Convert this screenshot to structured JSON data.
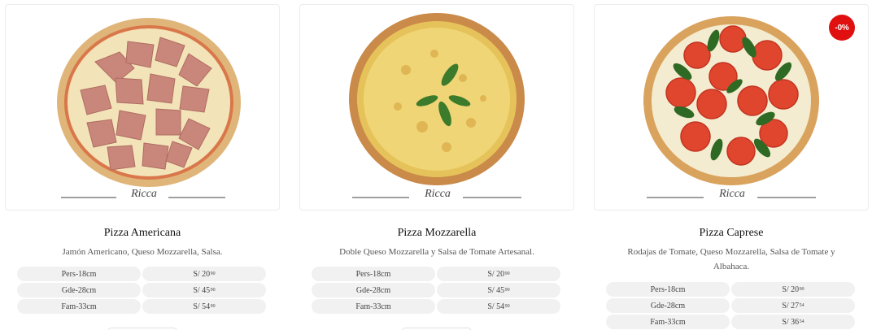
{
  "products": [
    {
      "name": "Pizza Americana",
      "description": "Jamón Americano, Queso Mozzarella, Salsa.",
      "brand": "Ricca",
      "sizes": [
        {
          "label": "Pers-18cm",
          "price_main": "S/ 20",
          "price_cents": "90"
        },
        {
          "label": "Gde-28cm",
          "price_main": "S/ 45",
          "price_cents": "90"
        },
        {
          "label": "Fam-33cm",
          "price_main": "S/ 54",
          "price_cents": "90"
        }
      ]
    },
    {
      "name": "Pizza Mozzarella",
      "description": "Doble Queso Mozzarella y Salsa de Tomate Artesanal.",
      "brand": "Ricca",
      "sizes": [
        {
          "label": "Pers-18cm",
          "price_main": "S/ 20",
          "price_cents": "90"
        },
        {
          "label": "Gde-28cm",
          "price_main": "S/ 45",
          "price_cents": "90"
        },
        {
          "label": "Fam-33cm",
          "price_main": "S/ 54",
          "price_cents": "90"
        }
      ]
    },
    {
      "name": "Pizza Caprese",
      "description": "Rodajas de Tomate, Queso Mozzarella, Salsa de Tomate y Albahaca.",
      "brand": "Ricca",
      "discount_badge": "-0%",
      "sizes": [
        {
          "label": "Pers-18cm",
          "price_main": "S/ 20",
          "price_cents": "90"
        },
        {
          "label": "Gde-28cm",
          "price_main": "S/ 27",
          "price_cents": "54"
        },
        {
          "label": "Fam-33cm",
          "price_main": "S/ 36",
          "price_cents": "54"
        }
      ]
    }
  ],
  "colors": {
    "badge": "#e01010",
    "row_bg": "#f1f1f1"
  }
}
